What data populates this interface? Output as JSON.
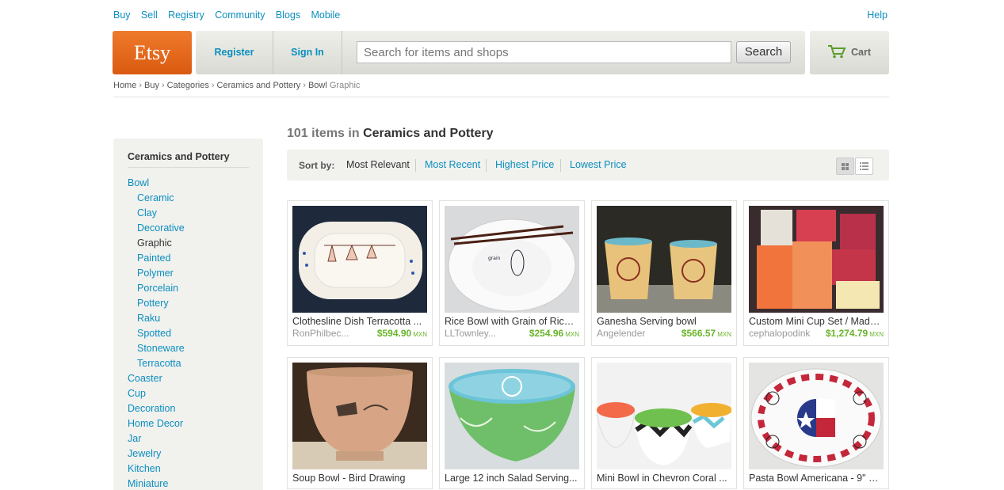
{
  "topnav": {
    "links": [
      "Buy",
      "Sell",
      "Registry",
      "Community",
      "Blogs",
      "Mobile"
    ],
    "help": "Help"
  },
  "header": {
    "logo": "Etsy",
    "register": "Register",
    "signin": "Sign In",
    "search_placeholder": "Search for items and shops",
    "search_button": "Search",
    "cart": "Cart"
  },
  "breadcrumb": [
    "Home",
    "Buy",
    "Categories",
    "Ceramics and Pottery",
    "Bowl"
  ],
  "breadcrumb_current": "Graphic",
  "sidebar": {
    "title": "Ceramics and Pottery",
    "items": [
      {
        "label": "Bowl",
        "sub": false,
        "active": false
      },
      {
        "label": "Ceramic",
        "sub": true,
        "active": false
      },
      {
        "label": "Clay",
        "sub": true,
        "active": false
      },
      {
        "label": "Decorative",
        "sub": true,
        "active": false
      },
      {
        "label": "Graphic",
        "sub": true,
        "active": true
      },
      {
        "label": "Painted",
        "sub": true,
        "active": false
      },
      {
        "label": "Polymer",
        "sub": true,
        "active": false
      },
      {
        "label": "Porcelain",
        "sub": true,
        "active": false
      },
      {
        "label": "Pottery",
        "sub": true,
        "active": false
      },
      {
        "label": "Raku",
        "sub": true,
        "active": false
      },
      {
        "label": "Spotted",
        "sub": true,
        "active": false
      },
      {
        "label": "Stoneware",
        "sub": true,
        "active": false
      },
      {
        "label": "Terracotta",
        "sub": true,
        "active": false
      },
      {
        "label": "Coaster",
        "sub": false,
        "active": false
      },
      {
        "label": "Cup",
        "sub": false,
        "active": false
      },
      {
        "label": "Decoration",
        "sub": false,
        "active": false
      },
      {
        "label": "Home Decor",
        "sub": false,
        "active": false
      },
      {
        "label": "Jar",
        "sub": false,
        "active": false
      },
      {
        "label": "Jewelry",
        "sub": false,
        "active": false
      },
      {
        "label": "Kitchen",
        "sub": false,
        "active": false
      },
      {
        "label": "Miniature",
        "sub": false,
        "active": false
      }
    ]
  },
  "results": {
    "count": "101 items in",
    "category": "Ceramics and Pottery"
  },
  "sort": {
    "label": "Sort by:",
    "options": [
      "Most Relevant",
      "Most Recent",
      "Highest Price",
      "Lowest Price"
    ]
  },
  "currency": "MXN",
  "listings": [
    {
      "title": "Clothesline Dish Terracotta ...",
      "shop": "RonPhilbec...",
      "price": "$594.90"
    },
    {
      "title": "Rice Bowl with Grain of Rice ...",
      "shop": "LLTownley...",
      "price": "$254.96"
    },
    {
      "title": "Ganesha Serving bowl",
      "shop": "Angelender",
      "price": "$566.57"
    },
    {
      "title": "Custom Mini Cup Set / Made...",
      "shop": "cephalopodink",
      "price": "$1,274.79"
    },
    {
      "title": "Soup Bowl - Bird Drawing",
      "shop": "",
      "price": ""
    },
    {
      "title": "Large 12 inch Salad Serving...",
      "shop": "",
      "price": ""
    },
    {
      "title": "Mini Bowl in Chevron Coral ...",
      "shop": "",
      "price": ""
    },
    {
      "title": "Pasta Bowl Americana - 9\" H...",
      "shop": "",
      "price": ""
    }
  ],
  "colors": {
    "link": "#0b8fbf",
    "logo": "#e2661a",
    "price": "#6ab42a"
  }
}
